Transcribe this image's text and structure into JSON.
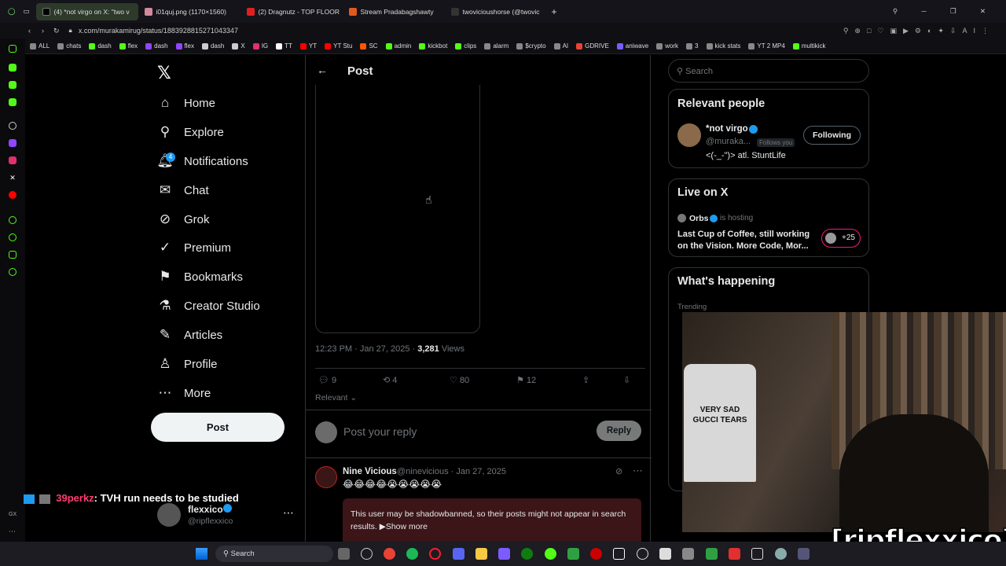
{
  "browser": {
    "tabs": [
      {
        "label": "(4) *not virgo on X: \"two v",
        "color": "#1d1d1d"
      },
      {
        "label": "i01quj.png (1170×1560)",
        "color": "#d08a9a"
      },
      {
        "label": "(2) Dragnutz - TOP FLOOR",
        "color": "#e02020"
      },
      {
        "label": "Stream Pradabagshawty",
        "color": "#e05a20"
      },
      {
        "label": "twovicioushorse (@twovic",
        "color": "#222"
      }
    ],
    "url": "x.com/murakamirug/status/1883928815271043347",
    "bookmarks": [
      "ALL",
      "chats",
      "dash",
      "flex",
      "dash",
      "flex",
      "dash",
      "X",
      "IG",
      "TT",
      "YT",
      "YT Stu",
      "SC",
      "admin",
      "kickbot",
      "clips",
      "alarm",
      "$crypto",
      "AI",
      "GDRIVE",
      "aniwave",
      "work",
      "3",
      "kick stats",
      "YT 2 MP4",
      "multikick"
    ],
    "bookmark_colors": [
      "#888",
      "#888",
      "#53fc18",
      "#53fc18",
      "#9146ff",
      "#9146ff",
      "#ccc",
      "#ccc",
      "#e1306c",
      "#fff",
      "#ff0000",
      "#ff0000",
      "#ff5500",
      "#53fc18",
      "#53fc18",
      "#53fc18",
      "#888",
      "#888",
      "#888",
      "#ea4335",
      "#7a5cff",
      "#888",
      "#888",
      "#888",
      "#888",
      "#53fc18"
    ]
  },
  "nav": {
    "logo": "𝕏",
    "items": [
      {
        "label": "Home",
        "icon": "home-icon",
        "glyph": "⌂"
      },
      {
        "label": "Explore",
        "icon": "search-icon",
        "glyph": "⚲"
      },
      {
        "label": "Notifications",
        "icon": "bell-icon",
        "glyph": "🔔︎"
      },
      {
        "label": "Chat",
        "icon": "mail-icon",
        "glyph": "✉"
      },
      {
        "label": "Grok",
        "icon": "grok-icon",
        "glyph": "⊘"
      },
      {
        "label": "Premium",
        "icon": "verified-icon",
        "glyph": "✓"
      },
      {
        "label": "Bookmarks",
        "icon": "bookmark-icon",
        "glyph": "⚑"
      },
      {
        "label": "Creator Studio",
        "icon": "flask-icon",
        "glyph": "⚗"
      },
      {
        "label": "Articles",
        "icon": "article-icon",
        "glyph": "✎"
      },
      {
        "label": "Profile",
        "icon": "person-icon",
        "glyph": "♙"
      },
      {
        "label": "More",
        "icon": "more-icon",
        "glyph": "⋯"
      }
    ],
    "notif_badge": "4",
    "post_label": "Post",
    "account": {
      "name": "flexxico",
      "handle": "@ripflexxico"
    }
  },
  "post": {
    "header": "Post",
    "timestamp": "12:23 PM · Jan 27, 2025 · ",
    "views_count": "3,281",
    "views_label": " Views",
    "actions": {
      "replies": "9",
      "reposts": "4",
      "likes": "80",
      "bookmarks": "12"
    },
    "sort_label": "Relevant",
    "reply_placeholder": "Post your reply",
    "reply_button": "Reply"
  },
  "reply": {
    "name": "Nine Vicious",
    "handle": "@ninevicious · Jan 27, 2025",
    "text": "😂😂😂😂😭😭😭😭😭",
    "notice": "This user may be shadowbanned, so their posts might not appear in search results.",
    "show_more": "▶Show more"
  },
  "sidebar": {
    "search_placeholder": "Search",
    "relevant_title": "Relevant people",
    "person": {
      "name": "*not virgo",
      "handle": "@muraka...",
      "follows": "Follows you",
      "bio": "<(-_-\")> atl. StuntLife",
      "button": "Following"
    },
    "live_title": "Live on X",
    "live": {
      "host": "Orbs",
      "hosting": "is hosting",
      "title": "Last Cup of Coffee, still working on the Vision. More Code, Mor...",
      "count": "+25"
    },
    "happening_title": "What's happening",
    "trending_label": "Trending"
  },
  "overlay": {
    "chat_user": "39perkz",
    "chat_text": ": TVH run needs to be studied",
    "watermark": "[ripflexxico]",
    "shirt_text": "VERY SAD GUCCI TEARS"
  },
  "taskbar": {
    "search": "Search"
  }
}
